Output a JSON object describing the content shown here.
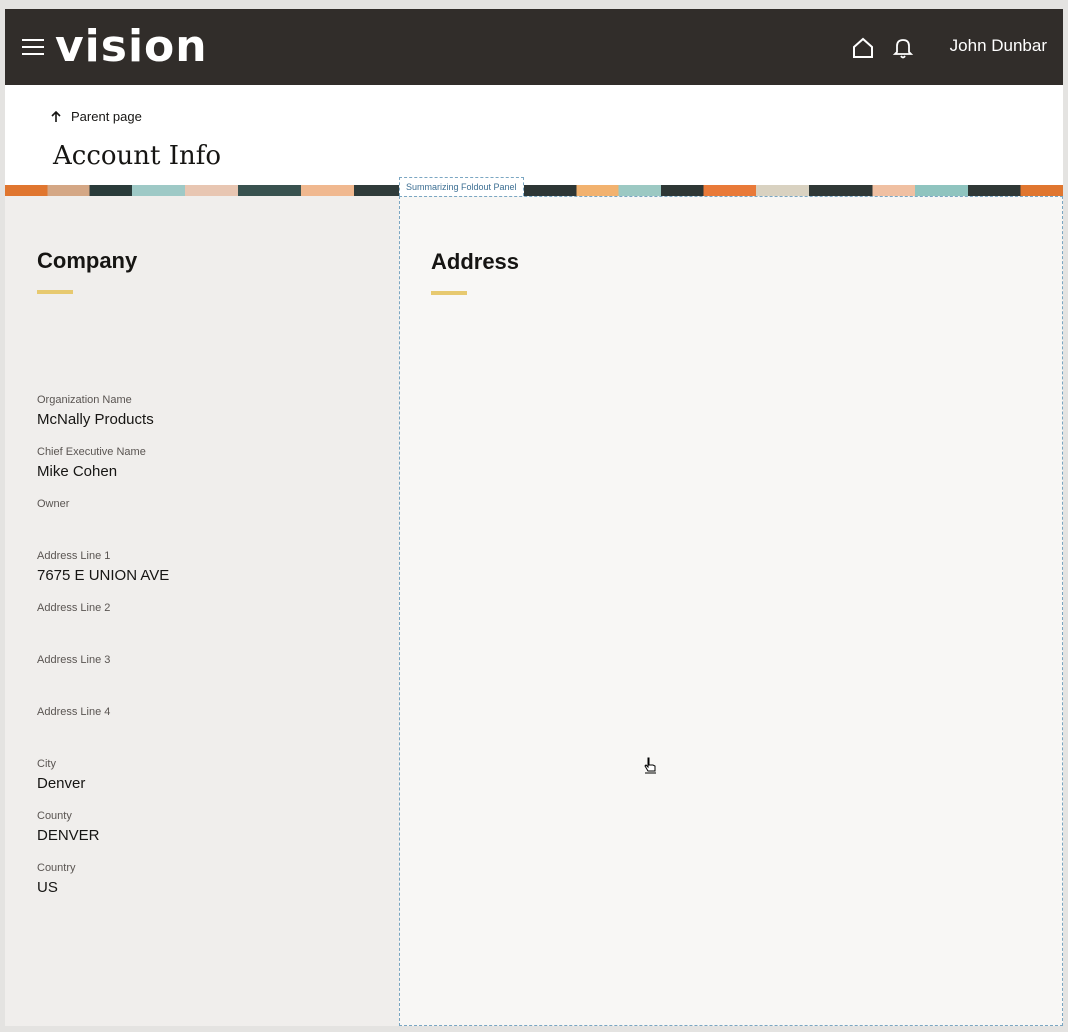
{
  "header": {
    "logo": "vision",
    "user_name": "John Dunbar",
    "icons": [
      "menu-icon",
      "home-icon",
      "bell-icon"
    ]
  },
  "breadcrumb": {
    "parent_label": "Parent page"
  },
  "page": {
    "title": "Account Info"
  },
  "foldout": {
    "tag_label": "Summarizing Foldout Panel"
  },
  "company": {
    "heading": "Company",
    "fields": [
      {
        "label": "Organization Name",
        "value": "McNally Products"
      },
      {
        "label": "Chief Executive Name",
        "value": "Mike Cohen"
      },
      {
        "label": "Owner",
        "value": ""
      },
      {
        "label": "Address Line 1",
        "value": "7675 E UNION AVE"
      },
      {
        "label": "Address Line 2",
        "value": ""
      },
      {
        "label": "Address Line 3",
        "value": ""
      },
      {
        "label": "Address Line 4",
        "value": ""
      },
      {
        "label": "City",
        "value": "Denver"
      },
      {
        "label": "County",
        "value": "DENVER"
      },
      {
        "label": "Country",
        "value": "US"
      }
    ]
  },
  "address": {
    "heading": "Address"
  },
  "colors": {
    "header_bg": "#312d2a",
    "accent": "#e7c96f",
    "panel_outline": "#7aa6c2",
    "left_panel_bg": "#f0eeec"
  }
}
